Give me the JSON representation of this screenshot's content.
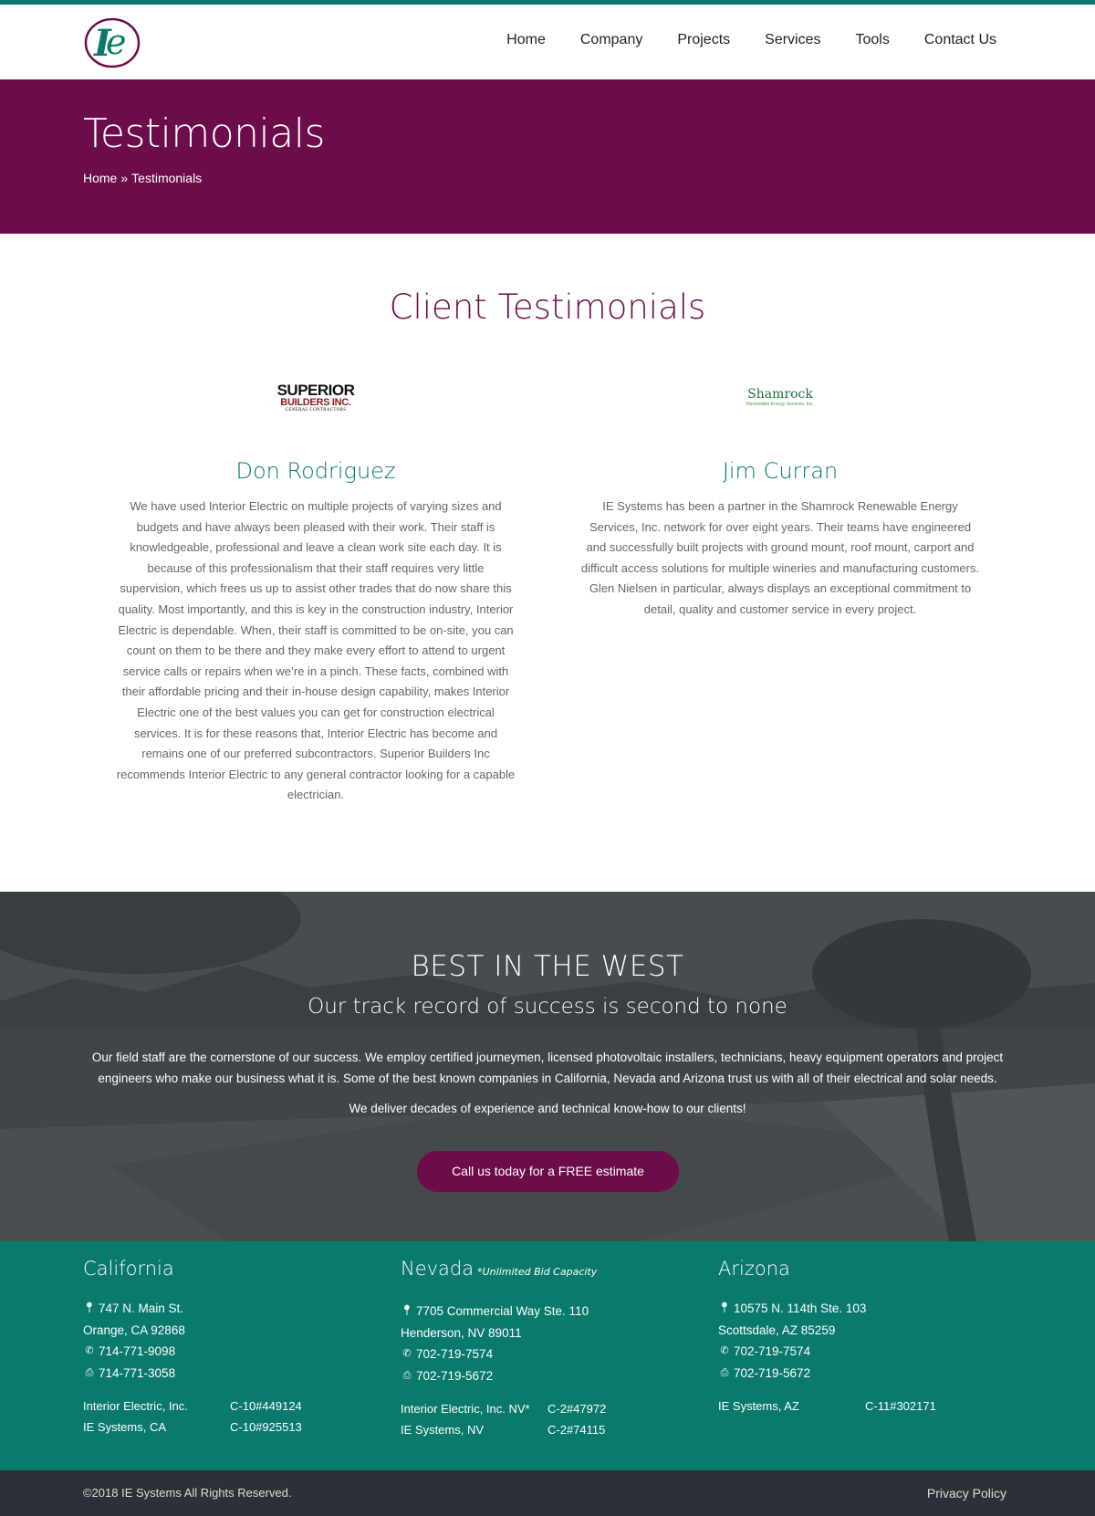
{
  "header": {
    "nav": [
      "Home",
      "Company",
      "Projects",
      "Services",
      "Tools",
      "Contact Us"
    ]
  },
  "banner": {
    "title": "Testimonials",
    "breadcrumb_home": "Home",
    "breadcrumb_sep": "»",
    "breadcrumb_current": "Testimonials"
  },
  "testimonials": {
    "section_title": "Client Testimonials",
    "items": [
      {
        "logo_line1": "SUPERIOR",
        "logo_line2": "BUILDERS INC.",
        "logo_line3": "GENERAL CONTRACTORS",
        "name": "Don Rodriguez",
        "text": "We have used Interior Electric on multiple projects of varying sizes and budgets and have always been pleased with their work. Their staff is knowledgeable, professional and leave a clean work site each day. It is because of this professionalism that their staff requires very little supervision, which frees us up to assist other trades that do now share this quality. Most importantly, and this is key in the construction industry, Interior Electric is dependable. When, their staff is committed to be on-site, you can count on them to be there and they make every effort to attend to urgent service calls or repairs when we’re in a pinch. These facts, combined with their affordable pricing and their in-house design capability, makes Interior Electric one of the best values you can get for construction electrical services. It is for these reasons that, Interior Electric has become and remains one of our preferred subcontractors. Superior Builders Inc recommends Interior Electric to any general contractor looking for a capable electrician."
      },
      {
        "logo_line1": "Shamrock",
        "logo_line2": "Renewable Energy Services, Inc.",
        "name": "Jim Curran",
        "text": "IE Systems has been a partner in the Shamrock Renewable Energy Services, Inc. network for over eight years. Their teams have engineered and successfully built projects with ground mount, roof mount, carport and difficult access solutions for multiple wineries and manufacturing customers. Glen Nielsen in particular, always displays an exceptional commitment to detail, quality and customer service in every project."
      }
    ]
  },
  "promo": {
    "title": "BEST IN THE WEST",
    "subtitle": "Our track record of success is second to none",
    "body": "Our field staff are the cornerstone of our success. We employ certified journeymen, licensed photovoltaic installers, technicians, heavy equipment operators and project engineers who make our business what it is. Some of the best known companies in California, Nevada and Arizona trust us with all of their electrical and solar needs.",
    "tagline": "We deliver decades of experience and technical know-how to our clients!",
    "cta": "Call us today for a FREE estimate"
  },
  "locations": [
    {
      "title": "California",
      "note": "",
      "address1": "747 N. Main St.",
      "address2": "Orange, CA 92868",
      "phone": "714-771-9098",
      "fax": "714-771-3058",
      "licenses": [
        {
          "name": "Interior Electric, Inc.",
          "number": "C-10#449124"
        },
        {
          "name": "IE Systems, CA",
          "number": "C-10#925513"
        }
      ]
    },
    {
      "title": "Nevada",
      "note": "*Unlimited Bid Capacity",
      "address1": "7705 Commercial Way Ste. 110",
      "address2": "Henderson, NV 89011",
      "phone": "702-719-7574",
      "fax": "702-719-5672",
      "licenses": [
        {
          "name": "Interior Electric, Inc. NV*",
          "number": "C-2#47972"
        },
        {
          "name": "IE Systems, NV",
          "number": "C-2#74115"
        }
      ]
    },
    {
      "title": "Arizona",
      "note": "",
      "address1": "10575 N. 114th Ste. 103",
      "address2": "Scottsdale, AZ 85259",
      "phone": "702-719-7574",
      "fax": "702-719-5672",
      "licenses": [
        {
          "name": "IE Systems, AZ",
          "number": "C-11#302171"
        }
      ]
    }
  ],
  "footer": {
    "copyright": "©2018 IE Systems All Rights Reserved.",
    "privacy": "Privacy Policy"
  },
  "icons": {
    "logo": "ie-logo-icon",
    "address": "map-marker-icon",
    "phone": "phone-icon",
    "fax": "fax-icon"
  },
  "colors": {
    "primary_purple": "#6d0c4b",
    "primary_teal": "#0a7a6c",
    "bottom_bar": "#2e3038"
  }
}
